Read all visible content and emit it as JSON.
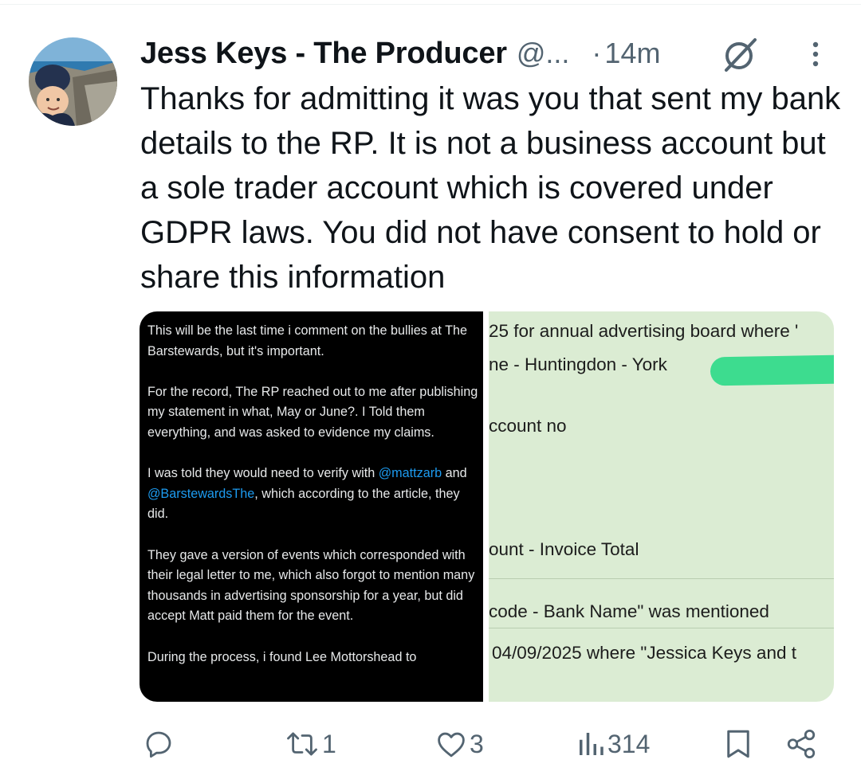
{
  "author": {
    "display_name": "Jess Keys - The Producer",
    "handle": "@...",
    "separator": "·",
    "time": "14m"
  },
  "tweet_text": "Thanks for admitting it was you that sent my bank details to the RP. It is not a business account but a sole trader account which is covered under GDPR laws. You did not have consent to hold or share this information",
  "media": {
    "left_post": {
      "para1": "This will be the last time i comment on the bullies at The Barstewards, but it's important.",
      "para2": "For the record, The RP reached out to me after publishing my statement in what, May or June?. I Told them everything, and was asked to evidence my claims.",
      "para3_a": "I was told they would need to verify with",
      "mention1": "@mattzarb",
      "para3_b": "and",
      "mention2": "@BarstewardsThe",
      "para3_c": ", which according to the article, they did.",
      "para4": "They gave a version of events which corresponded with their legal letter to me, which also forgot to mention many thousands in advertising sponsorship for a year, but did accept Matt paid them for the event.",
      "para5": "During the process, i found Lee Mottorshead to"
    },
    "right_doc": {
      "line1": "25 for annual advertising board where '",
      "line2": "ne - Huntingdon - York",
      "line3": "ccount no",
      "line4": "ount - Invoice Total",
      "line5": "code - Bank Name\" was mentioned",
      "line6": "04/09/2025 where \"Jessica Keys and t"
    }
  },
  "actions": {
    "replies": "",
    "reposts": "1",
    "likes": "3",
    "views": "314"
  },
  "colors": {
    "text": "#0f1419",
    "secondary": "#536471",
    "mention": "#1d9bf0",
    "doc_background": "#dbecd3",
    "redaction": "#3ddc8f"
  }
}
